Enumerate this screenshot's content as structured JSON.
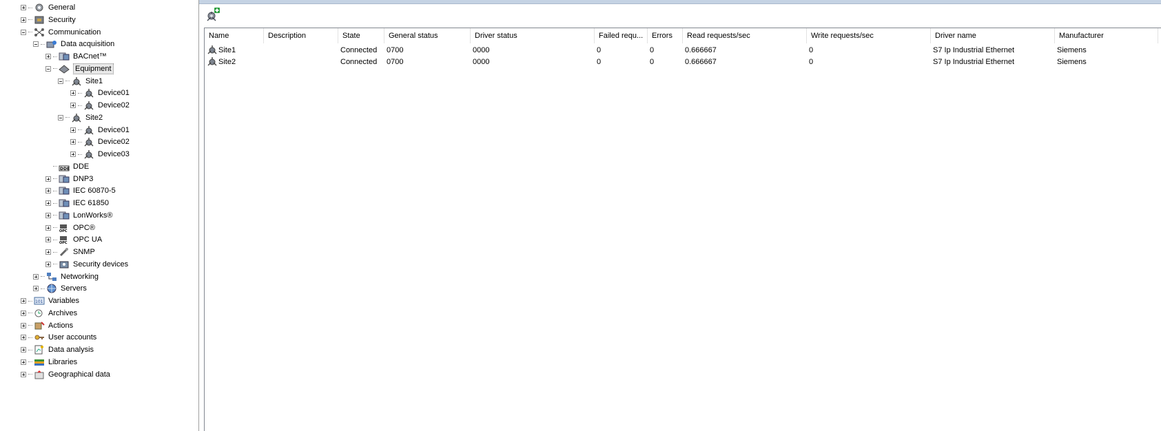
{
  "tree": [
    {
      "label": "General",
      "icon": "gear-icon",
      "indent": 0,
      "expander": "plus",
      "selected": false
    },
    {
      "label": "Security",
      "icon": "shield-icon",
      "indent": 0,
      "expander": "plus",
      "selected": false
    },
    {
      "label": "Communication",
      "icon": "network-hub-icon",
      "indent": 0,
      "expander": "minus",
      "selected": false
    },
    {
      "label": "Data acquisition",
      "icon": "data-acquisition-icon",
      "indent": 1,
      "expander": "minus",
      "selected": false
    },
    {
      "label": "BACnet™",
      "icon": "bacnet-icon",
      "indent": 2,
      "expander": "plus",
      "selected": false
    },
    {
      "label": "Equipment",
      "icon": "equipment-icon",
      "indent": 2,
      "expander": "minus",
      "selected": true
    },
    {
      "label": "Site1",
      "icon": "site-icon",
      "indent": 3,
      "expander": "minus",
      "selected": false
    },
    {
      "label": "Device01",
      "icon": "device-icon",
      "indent": 4,
      "expander": "plus",
      "selected": false
    },
    {
      "label": "Device02",
      "icon": "device-icon",
      "indent": 4,
      "expander": "plus",
      "selected": false
    },
    {
      "label": "Site2",
      "icon": "site-icon",
      "indent": 3,
      "expander": "minus",
      "selected": false
    },
    {
      "label": "Device01",
      "icon": "device-icon",
      "indent": 4,
      "expander": "plus",
      "selected": false
    },
    {
      "label": "Device02",
      "icon": "device-icon",
      "indent": 4,
      "expander": "plus",
      "selected": false
    },
    {
      "label": "Device03",
      "icon": "device-icon",
      "indent": 4,
      "expander": "plus",
      "selected": false
    },
    {
      "label": "DDE",
      "icon": "dde-icon",
      "indent": 2,
      "expander": "none",
      "selected": false
    },
    {
      "label": "DNP3",
      "icon": "dnp3-icon",
      "indent": 2,
      "expander": "plus",
      "selected": false
    },
    {
      "label": "IEC 60870-5",
      "icon": "iec-icon",
      "indent": 2,
      "expander": "plus",
      "selected": false
    },
    {
      "label": "IEC 61850",
      "icon": "iec-icon",
      "indent": 2,
      "expander": "plus",
      "selected": false
    },
    {
      "label": "LonWorks®",
      "icon": "lonworks-icon",
      "indent": 2,
      "expander": "plus",
      "selected": false
    },
    {
      "label": "OPC®",
      "icon": "opc-icon",
      "indent": 2,
      "expander": "plus",
      "selected": false
    },
    {
      "label": "OPC UA",
      "icon": "opc-icon",
      "indent": 2,
      "expander": "plus",
      "selected": false
    },
    {
      "label": "SNMP",
      "icon": "snmp-icon",
      "indent": 2,
      "expander": "plus",
      "selected": false
    },
    {
      "label": "Security devices",
      "icon": "security-device-icon",
      "indent": 2,
      "expander": "plus",
      "selected": false
    },
    {
      "label": "Networking",
      "icon": "networking-icon",
      "indent": 1,
      "expander": "plus",
      "selected": false
    },
    {
      "label": "Servers",
      "icon": "servers-icon",
      "indent": 1,
      "expander": "plus",
      "selected": false
    },
    {
      "label": "Variables",
      "icon": "variables-icon",
      "indent": 0,
      "expander": "plus",
      "selected": false
    },
    {
      "label": "Archives",
      "icon": "archives-icon",
      "indent": 0,
      "expander": "plus",
      "selected": false
    },
    {
      "label": "Actions",
      "icon": "actions-icon",
      "indent": 0,
      "expander": "plus",
      "selected": false
    },
    {
      "label": "User accounts",
      "icon": "key-icon",
      "indent": 0,
      "expander": "plus",
      "selected": false
    },
    {
      "label": "Data analysis",
      "icon": "data-analysis-icon",
      "indent": 0,
      "expander": "plus",
      "selected": false
    },
    {
      "label": "Libraries",
      "icon": "libraries-icon",
      "indent": 0,
      "expander": "plus",
      "selected": false
    },
    {
      "label": "Geographical data",
      "icon": "geo-data-icon",
      "indent": 0,
      "expander": "plus",
      "selected": false
    }
  ],
  "toolbar": {
    "add_icon": "add-site-icon"
  },
  "grid": {
    "columns": [
      "Name",
      "Description",
      "State",
      "General status",
      "Driver status",
      "Failed requ...",
      "Errors",
      "Read requests/sec",
      "Write requests/sec",
      "Driver name",
      "Manufacturer"
    ],
    "rows": [
      {
        "name": "Site1",
        "description": "",
        "state": "Connected",
        "general_status": "0700",
        "driver_status": "0000",
        "failed": "0",
        "errors": "0",
        "read_rps": "0.666667",
        "write_rps": "0",
        "driver_name": "S7 Ip Industrial Ethernet",
        "manufacturer": "Siemens"
      },
      {
        "name": "Site2",
        "description": "",
        "state": "Connected",
        "general_status": "0700",
        "driver_status": "0000",
        "failed": "0",
        "errors": "0",
        "read_rps": "0.666667",
        "write_rps": "0",
        "driver_name": "S7 Ip Industrial Ethernet",
        "manufacturer": "Siemens"
      }
    ]
  },
  "colors": {
    "selection": "#e8e8e8",
    "header_strip": "#c5d3e4",
    "grid_border": "#828790"
  }
}
